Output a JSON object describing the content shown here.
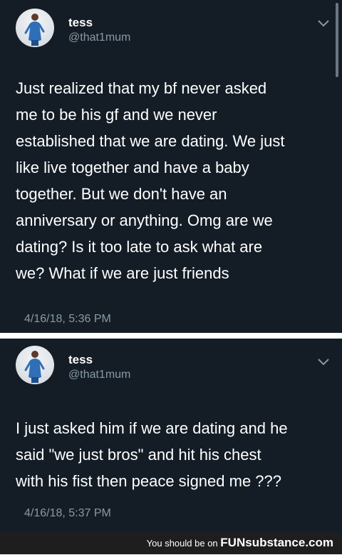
{
  "tweets": [
    {
      "name": "tess",
      "handle": "@that1mum",
      "lines": [
        "Just realized that my bf never asked",
        "me to be his gf and we never",
        "established that we are dating. We just",
        "like live together and have a baby",
        "together. But we don't have an",
        "anniversary or anything. Omg are we",
        "dating? Is it too late to ask what are",
        "we? What if we are just friends"
      ],
      "time": "4/16/18, 5:36 PM"
    },
    {
      "name": "tess",
      "handle": "@that1mum",
      "lines": [
        "I just asked him if we are dating and he",
        "said \"we just bros\" and hit his chest",
        "with his fist then peace signed me ???"
      ],
      "time": "4/16/18, 5:37 PM"
    }
  ],
  "footer": {
    "prefix": "You should be on",
    "brand": "FUNsubstance.com"
  },
  "colors": {
    "tweet_background": "#141d26",
    "secondary_text": "#8899a6",
    "separator": "#ffffff",
    "footer_background": "#1e1e1e"
  },
  "icons": {
    "avatar": "profile-photo",
    "menu": "chevron-down-icon"
  }
}
